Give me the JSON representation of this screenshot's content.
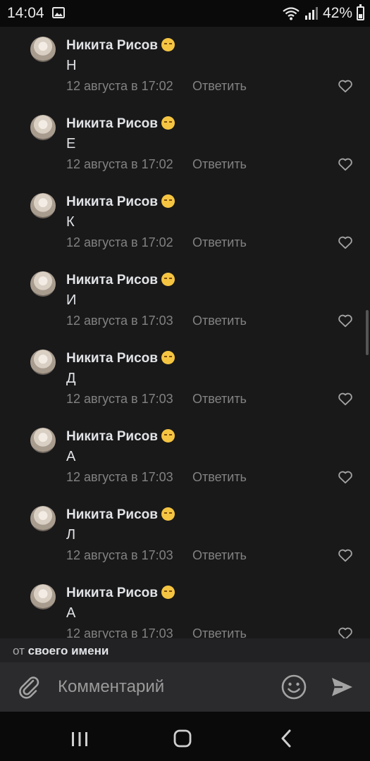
{
  "status_bar": {
    "time": "14:04",
    "battery": "42%"
  },
  "comments": [
    {
      "author": "Никита Рисов",
      "text": "Н",
      "date": "12 августа в 17:02",
      "reply": "Ответить"
    },
    {
      "author": "Никита Рисов",
      "text": "Е",
      "date": "12 августа в 17:02",
      "reply": "Ответить"
    },
    {
      "author": "Никита Рисов",
      "text": "К",
      "date": "12 августа в 17:02",
      "reply": "Ответить"
    },
    {
      "author": "Никита Рисов",
      "text": "И",
      "date": "12 августа в 17:03",
      "reply": "Ответить"
    },
    {
      "author": "Никита Рисов",
      "text": "Д",
      "date": "12 августа в 17:03",
      "reply": "Ответить"
    },
    {
      "author": "Никита Рисов",
      "text": "А",
      "date": "12 августа в 17:03",
      "reply": "Ответить"
    },
    {
      "author": "Никита Рисов",
      "text": "Л",
      "date": "12 августа в 17:03",
      "reply": "Ответить"
    },
    {
      "author": "Никита Рисов",
      "text": "А",
      "date": "12 августа в 17:03",
      "reply": "Ответить"
    }
  ],
  "sender": {
    "prefix": "от",
    "name": "своего имени"
  },
  "composer": {
    "placeholder": "Комментарий"
  },
  "icons": {
    "attach": "paperclip-icon",
    "emoji": "smile-icon",
    "send": "send-icon",
    "like": "heart-icon"
  },
  "colors": {
    "background": "#19191a",
    "secondary_text": "#828282",
    "primary_text": "#e1e3e6"
  }
}
